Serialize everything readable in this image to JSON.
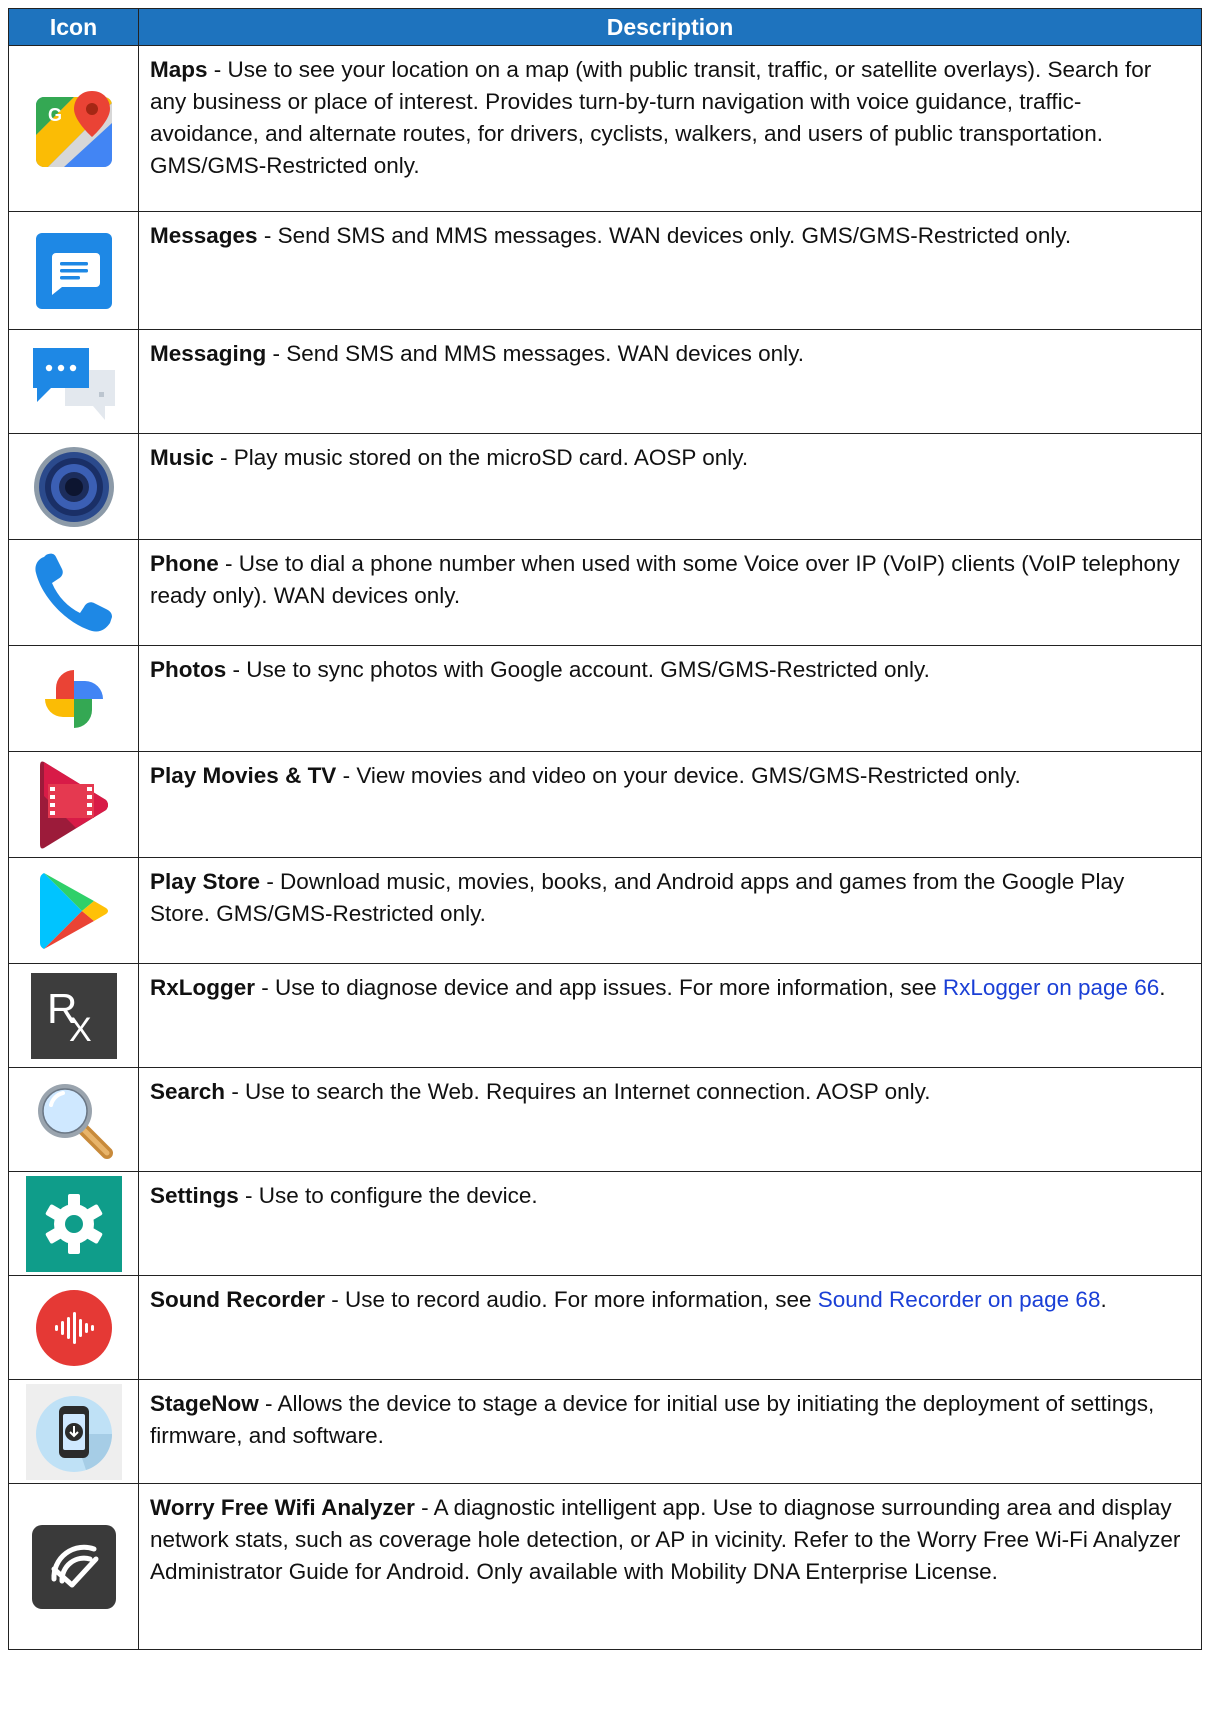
{
  "header": {
    "col_icon": "Icon",
    "col_description": "Description"
  },
  "rows": [
    {
      "icon": "maps-icon",
      "name": "Maps",
      "text": " - Use to see your location on a map (with public transit, traffic, or satellite overlays). Search for any business or place of interest. Provides turn-by-turn navigation with voice guidance, traffic-avoidance, and alternate routes, for drivers, cyclists, walkers, and users of public transportation. GMS/GMS-Restricted only."
    },
    {
      "icon": "messages-icon",
      "name": "Messages",
      "text": " - Send SMS and MMS messages. WAN devices only. GMS/GMS-Restricted only."
    },
    {
      "icon": "messaging-icon",
      "name": "Messaging",
      "text": " - Send SMS and MMS messages. WAN devices only."
    },
    {
      "icon": "music-speaker-icon",
      "name": "Music",
      "text": " - Play music stored on the microSD card. AOSP only."
    },
    {
      "icon": "phone-icon",
      "name": "Phone",
      "text": " - Use to dial a phone number when used with some Voice over IP (VoIP) clients (VoIP telephony ready only). WAN devices only."
    },
    {
      "icon": "photos-pinwheel-icon",
      "name": "Photos",
      "text": " - Use to sync photos with Google account. GMS/GMS-Restricted only."
    },
    {
      "icon": "play-movies-icon",
      "name": "Play Movies & TV",
      "text": " - View movies and video on your device. GMS/GMS-Restricted only."
    },
    {
      "icon": "play-store-icon",
      "name": "Play Store",
      "text": " - Download music, movies, books, and Android apps and games from the Google Play Store. GMS/GMS-Restricted only."
    },
    {
      "icon": "rxlogger-icon",
      "icon_text": "R",
      "icon_text_sub": "X",
      "name": "RxLogger",
      "text": " - Use to diagnose device and app issues. For more information, see ",
      "link": "RxLogger on page 66",
      "after": "."
    },
    {
      "icon": "search-magnifier-icon",
      "name": "Search",
      "text": " - Use to search the Web. Requires an Internet connection. AOSP only."
    },
    {
      "icon": "settings-gear-icon",
      "name": "Settings",
      "text": " - Use to configure the device."
    },
    {
      "icon": "sound-recorder-icon",
      "name": "Sound Recorder",
      "text": " - Use to record audio. For more information, see ",
      "link": "Sound Recorder on page 68",
      "after": "."
    },
    {
      "icon": "stagenow-icon",
      "name": "StageNow",
      "text": " - Allows the device to stage a device for initial use by initiating the deployment of settings, firmware, and software."
    },
    {
      "icon": "wifi-analyzer-icon",
      "name": "Worry Free Wifi Analyzer",
      "text": " - A diagnostic intelligent app. Use to diagnose surrounding area and display network stats, such as coverage hole detection, or AP in vicinity. Refer to the Worry Free Wi-Fi Analyzer Administrator Guide for Android. Only available with Mobility DNA Enterprise License."
    }
  ]
}
